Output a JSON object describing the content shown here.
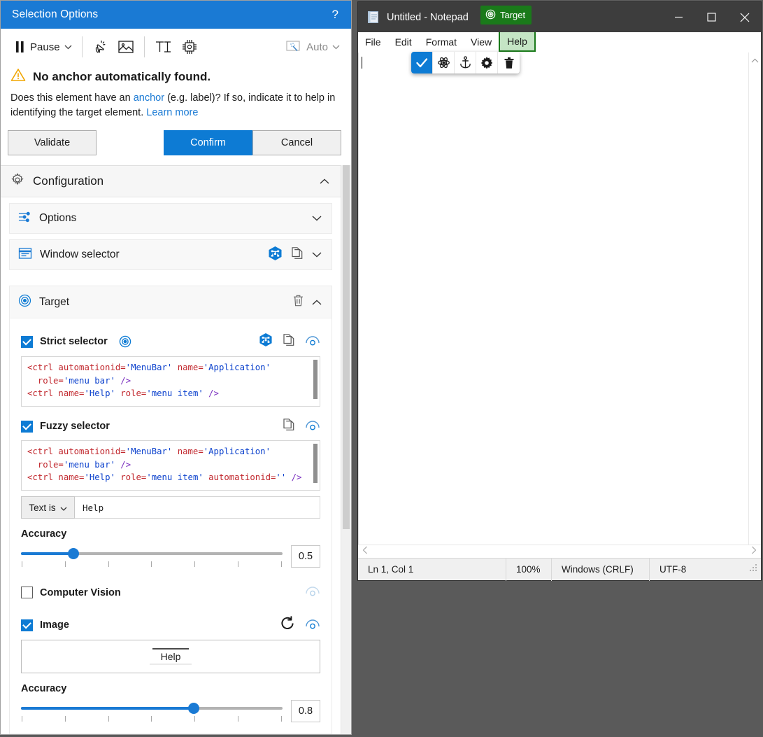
{
  "selection_panel": {
    "title": "Selection Options",
    "help_glyph": "?",
    "toolbar": {
      "pause_label": "Pause",
      "pause_chevron": "chevron-down-icon",
      "click_icon": "click-action-icon",
      "image_icon": "image-action-icon",
      "text_icon": "text-action-icon",
      "cv_icon": "chip-action-icon",
      "auto_label": "Auto",
      "auto_icon": "magic-wand-icon",
      "auto_chevron": "chevron-down-icon"
    },
    "warning": {
      "icon": "warning-triangle-icon",
      "heading": "No anchor automatically found.",
      "desc_part1": "Does this element have an ",
      "desc_link1": "anchor",
      "desc_part2": " (e.g. label)? If so, indicate it to help in identifying the target element. ",
      "desc_link2": "Learn more"
    },
    "actions": {
      "validate": "Validate",
      "confirm": "Confirm",
      "cancel": "Cancel"
    },
    "configuration": {
      "title": "Configuration",
      "icon": "gear-icon",
      "collapse_chevron": "chevron-up-icon",
      "options": {
        "title": "Options",
        "icon": "sliders-icon",
        "expand_chevron": "chevron-down-icon"
      },
      "window_selector": {
        "title": "Window selector",
        "icon": "window-selector-icon",
        "hex_icon": "ui-explorer-icon",
        "copy_icon": "copy-icon",
        "expand_chevron": "chevron-down-icon"
      },
      "target": {
        "title": "Target",
        "icon": "target-icon",
        "delete_icon": "trash-icon",
        "collapse_chevron": "chevron-up-icon",
        "strict_selector": {
          "label": "Strict selector",
          "checked": true,
          "target_icon": "target-icon",
          "hex_icon": "ui-explorer-icon",
          "copy_icon": "copy-icon",
          "indicate_icon": "indicate-icon",
          "code_lines": [
            [
              {
                "t": "<ctrl ",
                "c": "tag"
              },
              {
                "t": "automationid=",
                "c": "attr"
              },
              {
                "t": "'MenuBar'",
                "c": "val"
              },
              {
                "t": " ",
                "c": "plain"
              },
              {
                "t": "name=",
                "c": "attr"
              },
              {
                "t": "'Application'",
                "c": "val"
              }
            ],
            [
              {
                "t": "  ",
                "c": "plain"
              },
              {
                "t": "role=",
                "c": "attr"
              },
              {
                "t": "'menu bar'",
                "c": "val"
              },
              {
                "t": " ",
                "c": "plain"
              },
              {
                "t": "/>",
                "c": "punct"
              }
            ],
            [
              {
                "t": "<ctrl ",
                "c": "tag"
              },
              {
                "t": "name=",
                "c": "attr"
              },
              {
                "t": "'Help'",
                "c": "val"
              },
              {
                "t": " ",
                "c": "plain"
              },
              {
                "t": "role=",
                "c": "attr"
              },
              {
                "t": "'menu item'",
                "c": "val"
              },
              {
                "t": " ",
                "c": "plain"
              },
              {
                "t": "/>",
                "c": "punct"
              }
            ]
          ]
        },
        "fuzzy_selector": {
          "label": "Fuzzy selector",
          "checked": true,
          "copy_icon": "copy-icon",
          "indicate_icon": "indicate-icon",
          "code_lines": [
            [
              {
                "t": "<ctrl ",
                "c": "tag"
              },
              {
                "t": "automationid=",
                "c": "attr"
              },
              {
                "t": "'MenuBar'",
                "c": "val"
              },
              {
                "t": " ",
                "c": "plain"
              },
              {
                "t": "name=",
                "c": "attr"
              },
              {
                "t": "'Application'",
                "c": "val"
              }
            ],
            [
              {
                "t": "  ",
                "c": "plain"
              },
              {
                "t": "role=",
                "c": "attr"
              },
              {
                "t": "'menu bar'",
                "c": "val"
              },
              {
                "t": " ",
                "c": "plain"
              },
              {
                "t": "/>",
                "c": "punct"
              }
            ],
            [
              {
                "t": "<ctrl ",
                "c": "tag"
              },
              {
                "t": "name=",
                "c": "attr"
              },
              {
                "t": "'Help'",
                "c": "val"
              },
              {
                "t": " ",
                "c": "plain"
              },
              {
                "t": "role=",
                "c": "attr"
              },
              {
                "t": "'menu item'",
                "c": "val"
              },
              {
                "t": " ",
                "c": "plain"
              },
              {
                "t": "automationid=",
                "c": "attr"
              },
              {
                "t": "''",
                "c": "val"
              },
              {
                "t": " ",
                "c": "plain"
              },
              {
                "t": "/>",
                "c": "punct"
              }
            ]
          ],
          "match_mode": "Text is",
          "match_chevron": "chevron-down-icon",
          "match_value": "Help",
          "accuracy_label": "Accuracy",
          "accuracy_value": "0.5",
          "accuracy_percent": 20,
          "tick_count": 7
        },
        "computer_vision": {
          "label": "Computer Vision",
          "checked": false,
          "indicate_icon": "indicate-icon"
        },
        "image": {
          "label": "Image",
          "checked": true,
          "refresh_icon": "refresh-icon",
          "indicate_icon": "indicate-icon",
          "preview_text": "Help",
          "accuracy_label": "Accuracy",
          "accuracy_value": "0.8",
          "accuracy_percent": 66,
          "tick_count": 7
        }
      }
    }
  },
  "notepad": {
    "icon": "notepad-icon",
    "title": "Untitled - Notepad",
    "window_buttons": {
      "minimize": "minimize-icon",
      "maximize": "maximize-icon",
      "close": "close-icon"
    },
    "menus": [
      "File",
      "Edit",
      "Format",
      "View"
    ],
    "highlighted_menu": "Help",
    "scroll_up_arrow": "chevron-up-icon",
    "hscroll_left_arrow": "chevron-left-icon",
    "hscroll_right_arrow": "chevron-right-icon",
    "status": {
      "position": "Ln 1, Col 1",
      "zoom": "100%",
      "line_ending": "Windows (CRLF)",
      "encoding": "UTF-8",
      "grip": "resize-grip-icon"
    }
  },
  "target_badge": {
    "label": "Target",
    "icon": "target-icon"
  },
  "floating_toolbar": {
    "buttons": [
      {
        "name": "confirm-check-icon",
        "active": true
      },
      {
        "name": "atom-icon",
        "active": false
      },
      {
        "name": "anchor-icon",
        "active": false
      },
      {
        "name": "gear-icon",
        "active": false
      },
      {
        "name": "trash-icon",
        "active": false
      }
    ]
  },
  "colors": {
    "accent": "#1a7ad4",
    "confirm": "#0d7bd4",
    "target_green": "#1a7a1a",
    "warning": "#f0a500",
    "link": "#1a7ad4",
    "code_tag": "#c1272d",
    "code_value": "#0b41cd",
    "code_punct": "#7a2fbf",
    "desktop": "#5a5a5a"
  }
}
